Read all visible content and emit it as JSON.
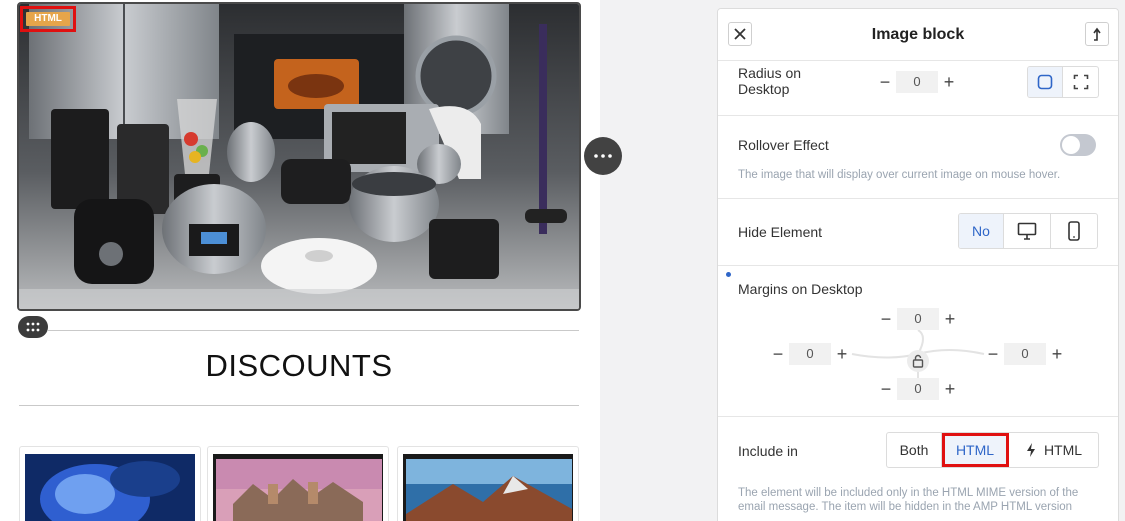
{
  "canvas": {
    "html_tag": "HTML",
    "heading": "DISCOUNTS"
  },
  "panel": {
    "title": "Image block",
    "radius": {
      "label": "Radius on Desktop",
      "value": "0"
    },
    "rollover": {
      "label": "Rollover Effect",
      "enabled": false,
      "hint": "The image that will display over current image on mouse hover."
    },
    "hide": {
      "label": "Hide Element",
      "options": {
        "no": "No"
      }
    },
    "margins": {
      "label": "Margins on Desktop",
      "top": "0",
      "left": "0",
      "right": "0",
      "bottom": "0"
    },
    "include": {
      "label": "Include in",
      "options": {
        "both": "Both",
        "html": "HTML",
        "amp": "HTML"
      },
      "selected": "HTML",
      "hint": "The element will be included only in the HTML MIME version of the email message. The item will be hidden in the AMP HTML version"
    }
  },
  "colors": {
    "accent": "#2f66c8",
    "highlight": "#e01010",
    "tag": "#e6a54a"
  }
}
